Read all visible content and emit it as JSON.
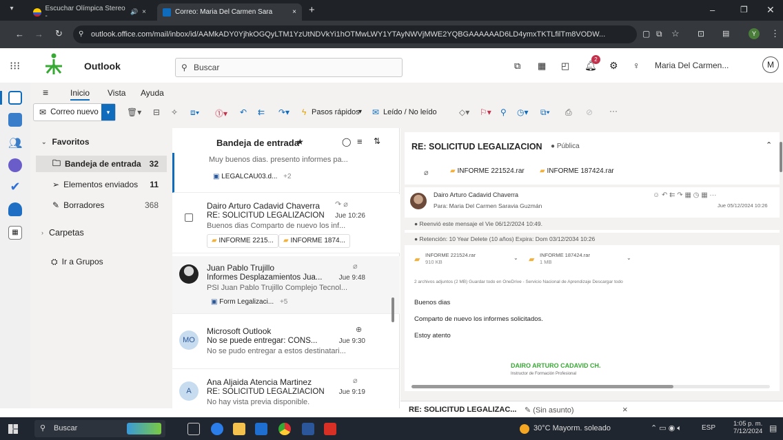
{
  "browser": {
    "tabs": [
      {
        "title": "Escuchar Olímpica Stereo -",
        "active": false
      },
      {
        "title": "Correo: Maria Del Carmen Sara",
        "active": true
      }
    ],
    "url": "outlook.office.com/mail/inbox/id/AAMkADY0YjhkOGQyLTM1YzUtNDVkYi1hOTMwLWY1YTAyNWVjMWE2YQBGAAAAAAD6LD4ymxTKTLfilTm8VODW..."
  },
  "app": {
    "title": "Outlook",
    "search_placeholder": "Buscar",
    "user_name": "Maria Del Carmen...",
    "user_initial": "M",
    "notification_count": "2"
  },
  "ribbon": {
    "tabs": [
      "Inicio",
      "Vista",
      "Ayuda"
    ],
    "new_mail": "Correo nuevo",
    "quick_steps": "Pasos rápidos",
    "read_unread": "Leído / No leído"
  },
  "folders": {
    "favorites_label": "Favoritos",
    "items": [
      {
        "name": "Bandeja de entrada",
        "count": "32"
      },
      {
        "name": "Elementos enviados",
        "count": "11"
      },
      {
        "name": "Borradores",
        "count": "368"
      }
    ],
    "folders_label": "Carpetas",
    "groups_label": "Ir a Grupos"
  },
  "message_list": {
    "title": "Bandeja de entrada",
    "messages": [
      {
        "preview": "Muy buenos dias. presento informes pa...",
        "attachment": "LEGALCAU03.d...",
        "more": "+2"
      },
      {
        "sender": "Dairo Arturo Cadavid Chaverra",
        "subject": "RE: SOLICITUD LEGALIZACION",
        "time": "Jue 10:26",
        "preview": "Buenos dias Comparto de nuevo los inf...",
        "attachments": [
          "INFORME 2215...",
          "INFORME 1874..."
        ]
      },
      {
        "sender": "Juan Pablo Trujillo",
        "subject": "Informes Desplazamientos Jua...",
        "time": "Jue 9:48",
        "preview": "PSI Juan Pablo Trujillo Complejo Tecnol...",
        "attachment": "Form Legalizaci...",
        "more": "+5"
      },
      {
        "sender": "Microsoft Outlook",
        "initials": "MO",
        "subject": "No se puede entregar: CONS...",
        "time": "Jue 9:30",
        "preview": "No se pudo entregar a estos destinatari..."
      },
      {
        "sender": "Ana Aljaida Atencia Martinez",
        "initials": "A",
        "subject": "RE: SOLICITUD LEGALZIACION",
        "time": "Jue 9:19",
        "preview": "No hay vista previa disponible."
      }
    ]
  },
  "reading": {
    "subject": "RE: SOLICITUD LEGALIZACION",
    "visibility": "Pública",
    "attachments_top": [
      "INFORME 221524.rar",
      "INFORME 187424.rar"
    ],
    "from": "Dairo Arturo Cadavid Chaverra",
    "to": "Para:  Maria Del Carmen Saravia Guzmán",
    "date": "Jue 05/12/2024 10:26",
    "forwarded": "Reenvió este mensaje el Vie 06/12/2024 10:49.",
    "retention": "Retención: 10 Year Delete (10 años) Expira: Dom 03/12/2034 10:26",
    "attachments": [
      {
        "name": "INFORME 221524.rar",
        "size": "910 KB"
      },
      {
        "name": "INFORME 187424.rar",
        "size": "1 MB"
      }
    ],
    "attach_actions": "2 archivos adjuntos (2 MB)   Guardar todo en OneDrive - Servicio Nacional de Aprendizaje   Descargar todo",
    "body": [
      "Buenos dias",
      "Comparto de nuevo los informes solicitados.",
      "Estoy atento"
    ],
    "signature_name": "DAIRO ARTURO CADAVID CH.",
    "signature_title": "Instructor de Formación Profesional"
  },
  "bottom_tabs": [
    "RE: SOLICITUD LEGALIZAC...",
    "(Sin asunto)"
  ],
  "taskbar": {
    "search": "Buscar",
    "weather": "30°C  Mayorm. soleado",
    "lang": "ESP",
    "time": "1:05 p. m.",
    "date": "7/12/2024"
  },
  "colors": {
    "accent": "#0f6cbd",
    "sena_green": "#39a935",
    "folder_yellow": "#f2b13b"
  }
}
